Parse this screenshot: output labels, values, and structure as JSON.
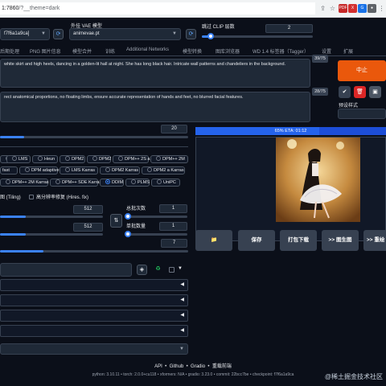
{
  "browser": {
    "url_host": "1:7860",
    "url_path": "/?__theme=dark",
    "ext_labels": [
      "PDF",
      "X",
      "G",
      "●",
      "☆",
      "◼"
    ]
  },
  "top": {
    "model_value": "f7f6a1a9ca]",
    "vae_label": "外挂 VAE 模型",
    "vae_value": "animevae.pt",
    "clip_label": "跳过 CLIP 层数",
    "clip_value": "2",
    "clip_fraction": 0.08
  },
  "tabs": [
    "后期处理",
    "PNG 图片信息",
    "模型合并",
    "训练",
    "Additional Networks",
    "模型转换",
    "图库浏览器",
    "WD 1.4 标签器（Tagger）",
    "设置",
    "扩展"
  ],
  "prompt": {
    "positive": "white skirt and high heels, dancing in a golden-lit hall at night. She has long black hair. Intricate wall patterns and chandeliers in the background.",
    "positive_counter": "39/75",
    "negative": "rect anatomical proportions, no floating limbs, ensure accurate representation of hands and feet, no blurred facial features.",
    "negative_counter": "28/75"
  },
  "actions": {
    "interrupt_label": "中止",
    "styles_label": "预设样式"
  },
  "left": {
    "steps_value": "20",
    "steps_fraction": 0.13,
    "samplers_row1": [
      "LMS",
      "Heun",
      "DPM2",
      "DPM2 a",
      "DPM++ 2S a",
      "DPM++ 2M"
    ],
    "samplers_row2": [
      "fast",
      "DPM adaptive",
      "LMS Karras",
      "DPM2 Karras",
      "DPM2 a Karras"
    ],
    "samplers_row3": [
      "DPM++ 2M Karras",
      "DPM++ SDE Karras",
      "DDIM",
      "PLMS",
      "UniPC"
    ],
    "selected_sampler": "DDIM",
    "tiling_label": "图 (Tiling)",
    "hires_label": "高分辨率修复 (Hires. fix)",
    "width_value": "512",
    "height_value": "512",
    "width_fraction": 0.25,
    "height_fraction": 0.25,
    "swap_icon": "⇅",
    "batch_count_label": "总批次数",
    "batch_count_value": "1",
    "batch_size_label": "单批数量",
    "batch_size_value": "1",
    "cfg_value": "7",
    "cfg_fraction": 0.23
  },
  "right": {
    "progress_text": "65% ETA: 01:12",
    "progress_fraction": 0.65,
    "buttons": [
      "📁",
      "保存",
      "打包下载",
      ">> 图生图",
      ">> 重绘"
    ]
  },
  "footer": {
    "links": [
      "API",
      "Github",
      "Gradio",
      "重载前端"
    ],
    "versions": "python: 3.10.11  •  torch: 2.0.0+cu118  •  xformers: N/A  •  gradio: 3.23.0  •  commit: 22bcc7be  •  checkpoint: f7f6a1a9ca"
  },
  "watermark": "@稀土掘金技术社区"
}
